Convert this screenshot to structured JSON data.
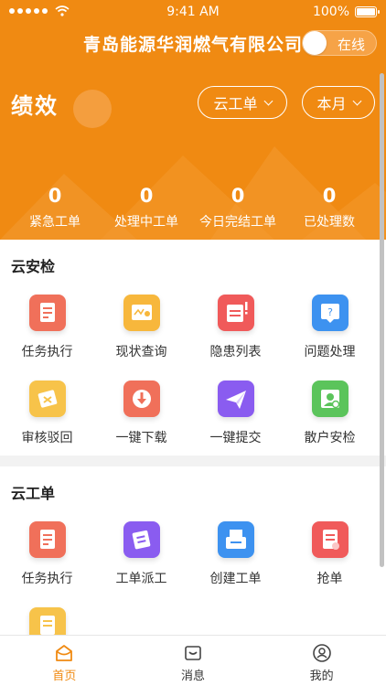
{
  "status_bar": {
    "time": "9:41 AM",
    "battery": "100%"
  },
  "header": {
    "company": "青岛能源华润燃气有限公司",
    "online_label": "在线",
    "perf_title": "绩效",
    "type_select": "云工单",
    "period_select": "本月"
  },
  "stats": [
    {
      "value": "0",
      "label": "紧急工单"
    },
    {
      "value": "0",
      "label": "处理中工单"
    },
    {
      "value": "0",
      "label": "今日完结工单"
    },
    {
      "value": "0",
      "label": "已处理数"
    }
  ],
  "security_section": {
    "title": "云安检",
    "items": [
      {
        "label": "任务执行",
        "icon": "task-execute-icon",
        "color": "#f0705a"
      },
      {
        "label": "现状查询",
        "icon": "status-query-icon",
        "color": "#f7b73c"
      },
      {
        "label": "隐患列表",
        "icon": "hazard-list-icon",
        "color": "#f05a5a"
      },
      {
        "label": "问题处理",
        "icon": "question-handle-icon",
        "color": "#3d92f0"
      },
      {
        "label": "审核驳回",
        "icon": "audit-reject-icon",
        "color": "#f7c34a"
      },
      {
        "label": "一键下载",
        "icon": "download-icon",
        "color": "#f0705a"
      },
      {
        "label": "一键提交",
        "icon": "submit-icon",
        "color": "#8a5cf0"
      },
      {
        "label": "散户安检",
        "icon": "household-check-icon",
        "color": "#5bc45b"
      }
    ]
  },
  "workorder_section": {
    "title": "云工单",
    "items": [
      {
        "label": "任务执行",
        "icon": "task-execute-icon",
        "color": "#f0705a"
      },
      {
        "label": "工单派工",
        "icon": "dispatch-icon",
        "color": "#8a5cf0"
      },
      {
        "label": "创建工单",
        "icon": "create-order-icon",
        "color": "#3d92f0"
      },
      {
        "label": "抢单",
        "icon": "grab-order-icon",
        "color": "#f05a5a"
      },
      {
        "label": "",
        "icon": "partial-document-icon",
        "color": "#f7c34a"
      }
    ]
  },
  "tabbar": {
    "tabs": [
      {
        "label": "首页",
        "icon": "home-icon",
        "active": true
      },
      {
        "label": "消息",
        "icon": "message-icon",
        "active": false
      },
      {
        "label": "我的",
        "icon": "profile-icon",
        "active": false
      }
    ],
    "active_color": "#f08a12"
  },
  "colors": {
    "brand": "#f08a12"
  }
}
